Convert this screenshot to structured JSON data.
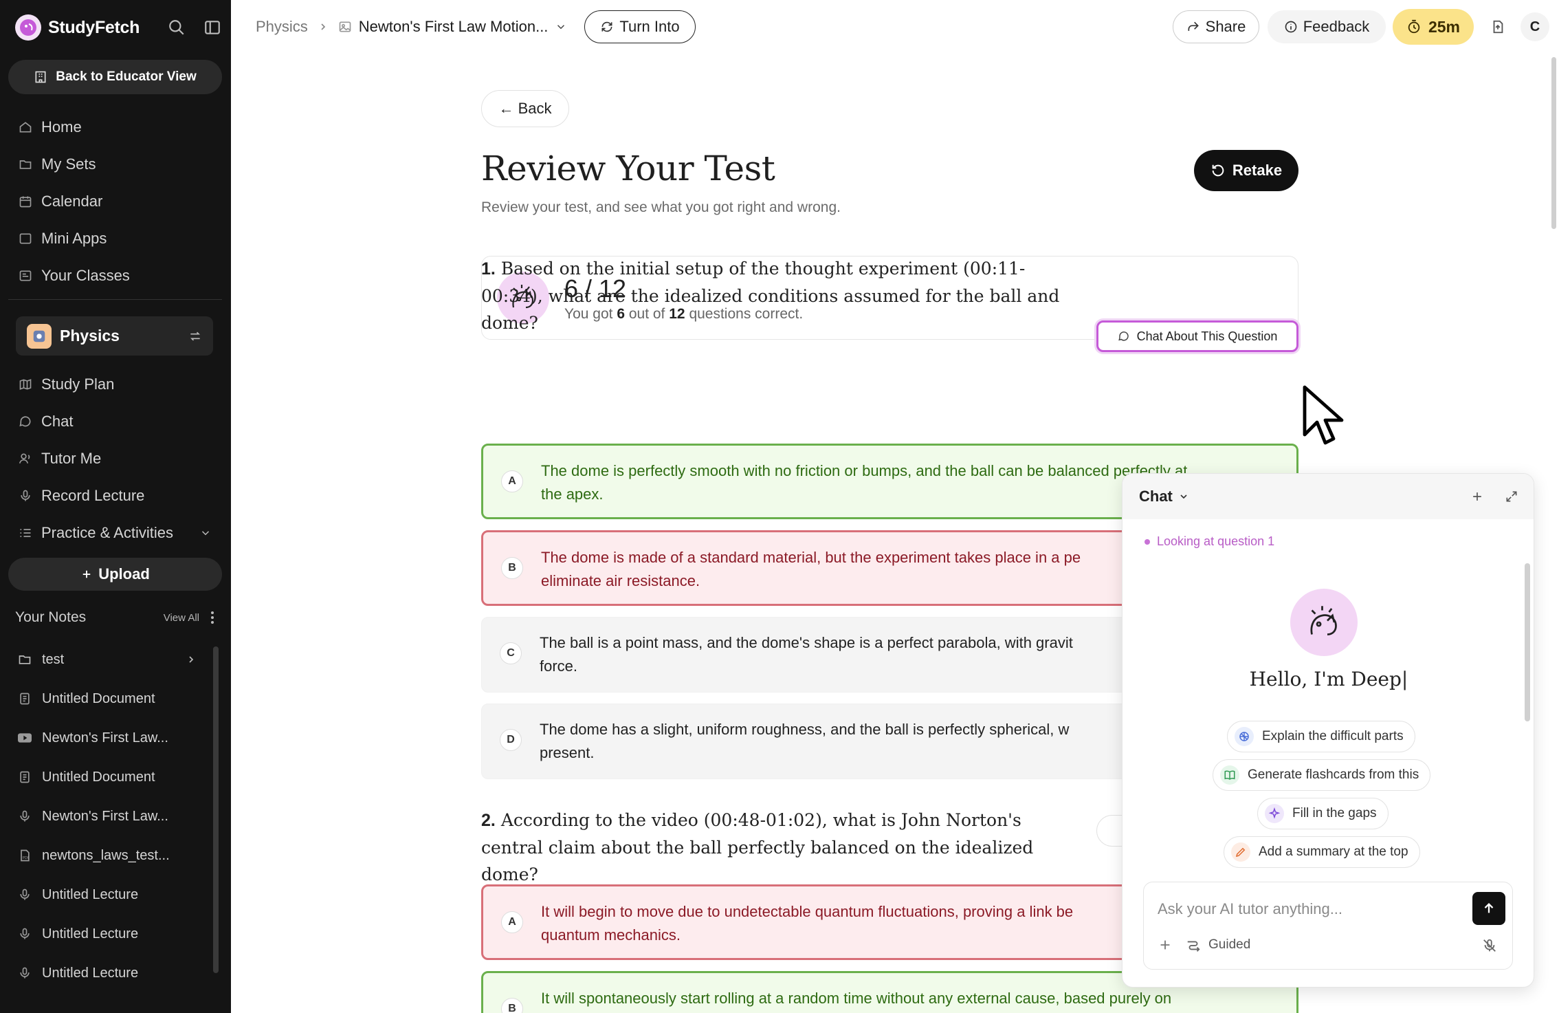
{
  "sidebar": {
    "brand": "StudyFetch",
    "back_to_educator": "Back to Educator View",
    "nav": [
      {
        "label": "Home",
        "icon": "home-icon"
      },
      {
        "label": "My Sets",
        "icon": "folder-icon"
      },
      {
        "label": "Calendar",
        "icon": "calendar-icon"
      },
      {
        "label": "Mini Apps",
        "icon": "window-icon"
      },
      {
        "label": "Your Classes",
        "icon": "classes-icon"
      }
    ],
    "class_name": "Physics",
    "class_nav": [
      {
        "label": "Study Plan",
        "icon": "map-icon"
      },
      {
        "label": "Chat",
        "icon": "chat-bubble-icon"
      },
      {
        "label": "Tutor Me",
        "icon": "tutor-icon"
      },
      {
        "label": "Record Lecture",
        "icon": "microphone-icon"
      },
      {
        "label": "Practice & Activities",
        "icon": "list-icon"
      }
    ],
    "upload": "Upload",
    "notes_title": "Your Notes",
    "view_all": "View All",
    "notes": [
      {
        "label": "test",
        "icon": "folder-icon"
      },
      {
        "label": "Untitled Document",
        "icon": "document-icon"
      },
      {
        "label": "Newton's First Law...",
        "icon": "youtube-icon"
      },
      {
        "label": "Untitled Document",
        "icon": "document-icon"
      },
      {
        "label": "Newton's First Law...",
        "icon": "microphone-icon"
      },
      {
        "label": "newtons_laws_test...",
        "icon": "pdf-icon"
      },
      {
        "label": "Untitled Lecture",
        "icon": "microphone-icon"
      },
      {
        "label": "Untitled Lecture",
        "icon": "microphone-icon"
      },
      {
        "label": "Untitled Lecture",
        "icon": "microphone-icon"
      }
    ]
  },
  "topbar": {
    "breadcrumb_root": "Physics",
    "breadcrumb_current": "Newton's First Law Motion...",
    "turn_into": "Turn Into",
    "share": "Share",
    "feedback": "Feedback",
    "timer": "25m",
    "avatar_initial": "C"
  },
  "main": {
    "back": "← Back",
    "title": "Review Your Test",
    "subtitle": "Review your test, and see what you got right and wrong.",
    "retake": "Retake",
    "score": {
      "display": "6 / 12",
      "prefix": "You got",
      "correct": "6",
      "mid": "out of",
      "total": "12",
      "suffix": "questions correct."
    },
    "chat_about": "Chat About This Question",
    "questions": [
      {
        "num": "1.",
        "text": "Based on the initial setup of the thought experiment (00:11-00:34), what are the idealized conditions assumed for the ball and dome?",
        "options": [
          {
            "letter": "A",
            "state": "correct",
            "l1": "The dome is perfectly smooth with no friction or bumps, and the ball can be balanced perfectly at",
            "l2": "the apex."
          },
          {
            "letter": "B",
            "state": "wrong",
            "l1": "The dome is made of a standard material, but the experiment takes place in a pe",
            "l2": "eliminate air resistance."
          },
          {
            "letter": "C",
            "state": "neutral",
            "l1": "The ball is a point mass, and the dome's shape is a perfect parabola, with gravit",
            "l2": "force."
          },
          {
            "letter": "D",
            "state": "neutral",
            "l1": "The dome has a slight, uniform roughness, and the ball is perfectly spherical, w",
            "l2": "present."
          }
        ]
      },
      {
        "num": "2.",
        "text": "According to the video (00:48-01:02), what is John Norton's central claim about the ball perfectly balanced on the idealized dome?",
        "options": [
          {
            "letter": "A",
            "state": "wrong",
            "l1": "It will begin to move due to undetectable quantum fluctuations, proving a link be",
            "l2": "quantum mechanics."
          },
          {
            "letter": "B",
            "state": "correct",
            "l1": "It will spontaneously start rolling at a random time without any external cause, based purely on",
            "l2": ""
          }
        ]
      }
    ]
  },
  "chat": {
    "title": "Chat",
    "looking": "Looking at question 1",
    "hello": "Hello, I'm Deep|",
    "chips": [
      {
        "label": "Explain the difficult parts",
        "icon": "brain-icon"
      },
      {
        "label": "Generate flashcards from this",
        "icon": "book-icon"
      },
      {
        "label": "Fill in the gaps",
        "icon": "sparkle-icon"
      },
      {
        "label": "Add a summary at the top",
        "icon": "pencil-icon"
      }
    ],
    "placeholder": "Ask your AI tutor anything...",
    "mode": "Guided"
  },
  "colors": {
    "accent_pink": "#c55ad8",
    "correct_green": "#6ab04c",
    "wrong_red": "#d86f78",
    "timer_yellow": "#fbe38a"
  }
}
